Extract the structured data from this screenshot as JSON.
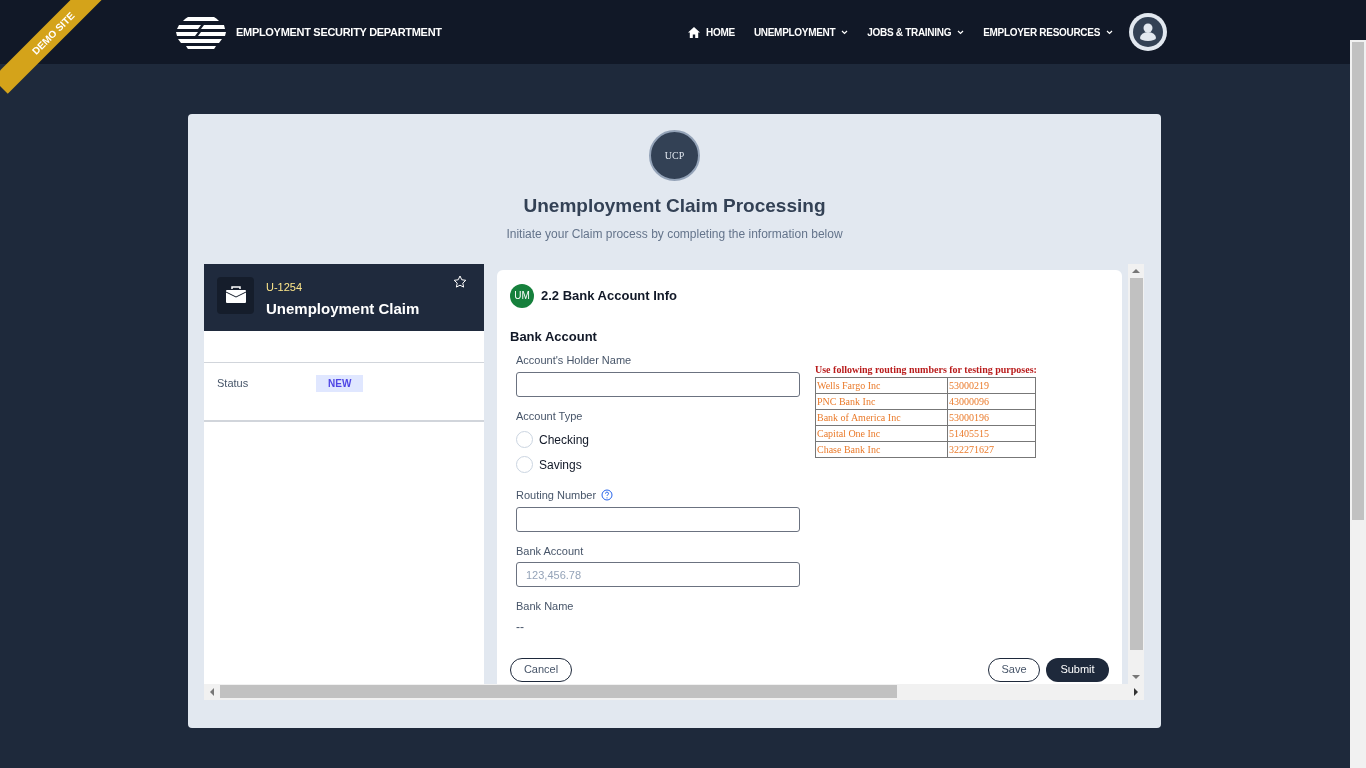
{
  "ribbon": "DEMO SITE",
  "header": {
    "brand": "EMPLOYMENT SECURITY DEPARTMENT",
    "nav": [
      {
        "label": "HOME",
        "kind": "home"
      },
      {
        "label": "UNEMPLOYMENT",
        "kind": "dropdown"
      },
      {
        "label": "JOBS & TRAINING",
        "kind": "dropdown"
      },
      {
        "label": "EMPLOYER RESOURCES",
        "kind": "dropdown"
      }
    ]
  },
  "app": {
    "logo": "UCP",
    "title": "Unemployment Claim Processing",
    "subtitle": "Initiate your Claim process by completing the information below"
  },
  "case": {
    "id": "U-1254",
    "name": "Unemployment Claim",
    "fields": [
      {
        "label": "Status",
        "value": "NEW"
      }
    ]
  },
  "step": {
    "badge": "UM",
    "title": "2.2 Bank Account Info",
    "section": "Bank Account",
    "holder": {
      "label": "Account's Holder Name"
    },
    "account_type": {
      "label": "Account Type",
      "options": [
        {
          "label": "Checking",
          "selected": false
        },
        {
          "label": "Savings",
          "selected": false
        }
      ]
    },
    "routing": {
      "label": "Routing Number"
    },
    "bank_account": {
      "label": "Bank Account",
      "placeholder": "123,456.78"
    },
    "bank_name": {
      "label": "Bank Name",
      "value": "--"
    },
    "hint": {
      "title": "Use following routing numbers for testing purposes:",
      "rows": [
        {
          "bank": "Wells Fargo Inc",
          "number": "53000219"
        },
        {
          "bank": "PNC Bank Inc",
          "number": "43000096"
        },
        {
          "bank": "Bank of America Inc",
          "number": "53000196"
        },
        {
          "bank": "Capital One Inc",
          "number": "51405515"
        },
        {
          "bank": "Chase Bank Inc",
          "number": "322271627"
        }
      ]
    },
    "buttons": {
      "cancel": "Cancel",
      "save": "Save",
      "submit": "Submit"
    }
  }
}
